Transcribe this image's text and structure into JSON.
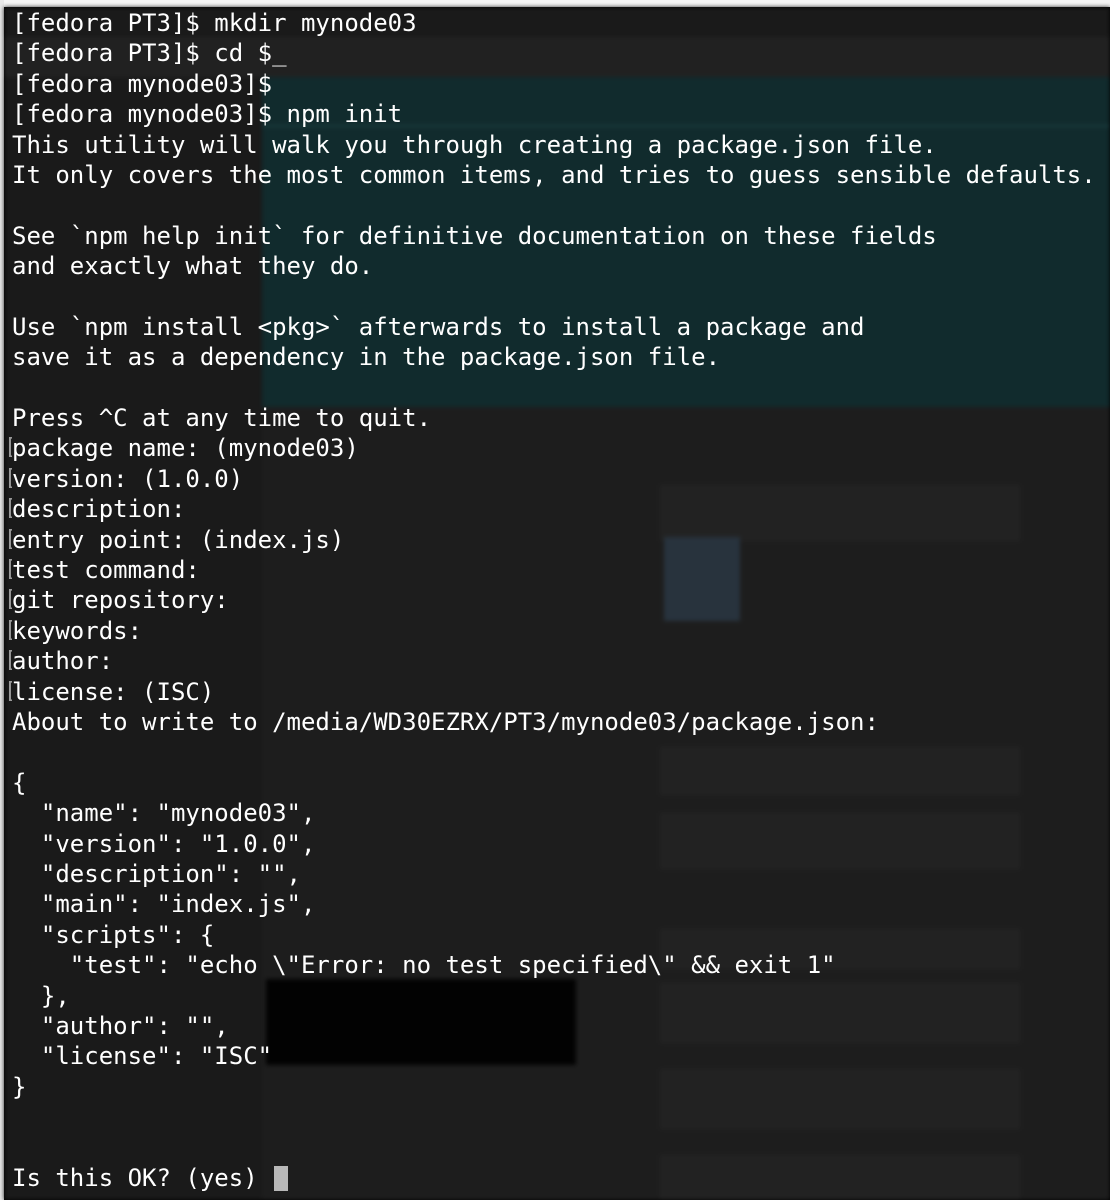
{
  "terminal": {
    "prompt_mark": "[",
    "lines": [
      {
        "text": "[fedora PT3]$ mkdir mynode03",
        "marked": false
      },
      {
        "text": "[fedora PT3]$ cd $_",
        "marked": false
      },
      {
        "text": "[fedora mynode03]$",
        "marked": false
      },
      {
        "text": "[fedora mynode03]$ npm init",
        "marked": false
      },
      {
        "text": "This utility will walk you through creating a package.json file.",
        "marked": false
      },
      {
        "text": "It only covers the most common items, and tries to guess sensible defaults.",
        "marked": false
      },
      {
        "text": "",
        "marked": false
      },
      {
        "text": "See `npm help init` for definitive documentation on these fields",
        "marked": false
      },
      {
        "text": "and exactly what they do.",
        "marked": false
      },
      {
        "text": "",
        "marked": false
      },
      {
        "text": "Use `npm install <pkg>` afterwards to install a package and",
        "marked": false
      },
      {
        "text": "save it as a dependency in the package.json file.",
        "marked": false
      },
      {
        "text": "",
        "marked": false
      },
      {
        "text": "Press ^C at any time to quit.",
        "marked": false
      },
      {
        "text": "package name: (mynode03)",
        "marked": true
      },
      {
        "text": "version: (1.0.0)",
        "marked": true
      },
      {
        "text": "description:",
        "marked": true
      },
      {
        "text": "entry point: (index.js)",
        "marked": true
      },
      {
        "text": "test command:",
        "marked": true
      },
      {
        "text": "git repository:",
        "marked": true
      },
      {
        "text": "keywords:",
        "marked": true
      },
      {
        "text": "author:",
        "marked": true
      },
      {
        "text": "license: (ISC)",
        "marked": true
      },
      {
        "text": "About to write to /media/WD30EZRX/PT3/mynode03/package.json:",
        "marked": false
      },
      {
        "text": "",
        "marked": false
      },
      {
        "text": "{",
        "marked": false
      },
      {
        "text": "  \"name\": \"mynode03\",",
        "marked": false
      },
      {
        "text": "  \"version\": \"1.0.0\",",
        "marked": false
      },
      {
        "text": "  \"description\": \"\",",
        "marked": false
      },
      {
        "text": "  \"main\": \"index.js\",",
        "marked": false
      },
      {
        "text": "  \"scripts\": {",
        "marked": false
      },
      {
        "text": "    \"test\": \"echo \\\"Error: no test specified\\\" && exit 1\"",
        "marked": false
      },
      {
        "text": "  },",
        "marked": false
      },
      {
        "text": "  \"author\": \"\",",
        "marked": false
      },
      {
        "text": "  \"license\": \"ISC\"",
        "marked": false
      },
      {
        "text": "}",
        "marked": false
      },
      {
        "text": "",
        "marked": false
      },
      {
        "text": "",
        "marked": false
      }
    ],
    "input_prompt": "Is this OK? (yes) "
  },
  "colors": {
    "text": "#ffffff",
    "terminal_background": "#000000",
    "cursor": "#b8b8b8",
    "backdrop_header": "#1e4a4e"
  }
}
